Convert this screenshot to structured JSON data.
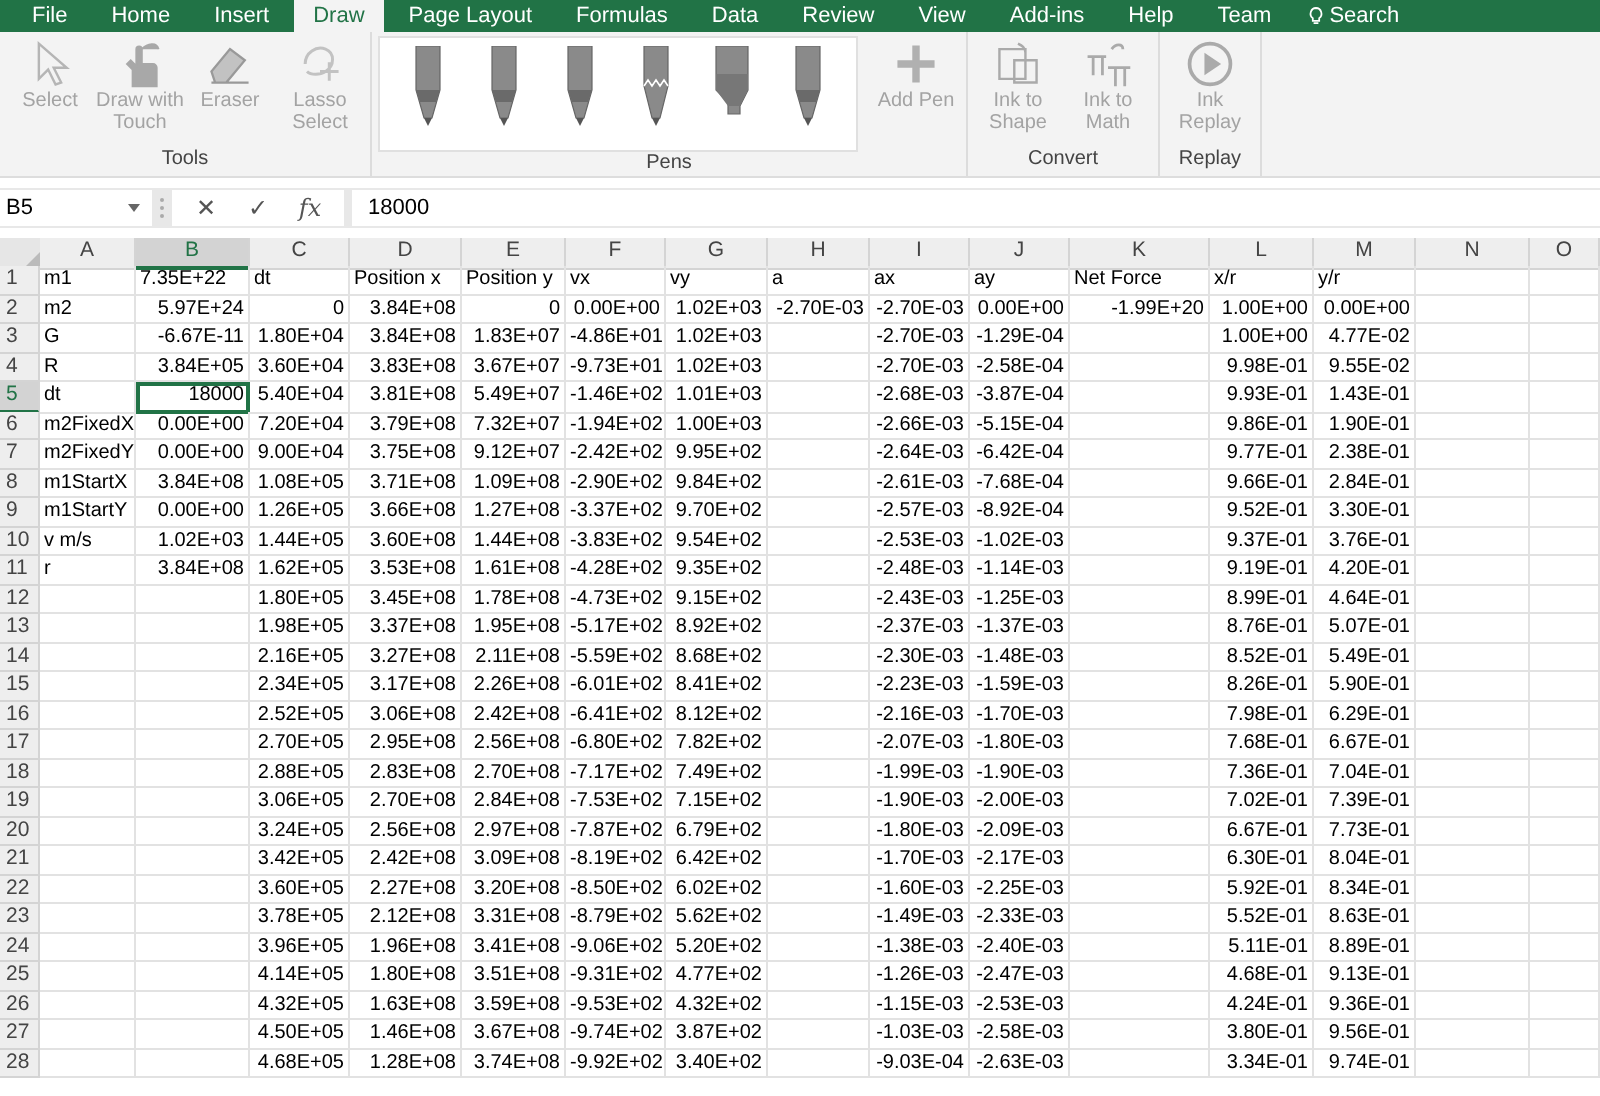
{
  "ribbon_tabs": [
    {
      "label": "File",
      "selected": false
    },
    {
      "label": "Home",
      "selected": false
    },
    {
      "label": "Insert",
      "selected": false
    },
    {
      "label": "Draw",
      "selected": true
    },
    {
      "label": "Page Layout",
      "selected": false
    },
    {
      "label": "Formulas",
      "selected": false
    },
    {
      "label": "Data",
      "selected": false
    },
    {
      "label": "Review",
      "selected": false
    },
    {
      "label": "View",
      "selected": false
    },
    {
      "label": "Add-ins",
      "selected": false
    },
    {
      "label": "Help",
      "selected": false
    },
    {
      "label": "Team",
      "selected": false
    }
  ],
  "tell_me": {
    "label": "Search"
  },
  "ribbon_groups": [
    {
      "label": "Tools",
      "buttons": [
        {
          "kind": "select",
          "label": "Select",
          "disabled": true
        },
        {
          "kind": "touch",
          "label": "Draw with Touch",
          "disabled": true
        },
        {
          "kind": "eraser",
          "label": "Eraser",
          "disabled": true
        },
        {
          "kind": "lasso",
          "label": "Lasso Select",
          "disabled": true
        }
      ]
    },
    {
      "label": "Pens",
      "pens": [
        {
          "kind": "pen"
        },
        {
          "kind": "pen"
        },
        {
          "kind": "pen"
        },
        {
          "kind": "pencil"
        },
        {
          "kind": "highlighter"
        },
        {
          "kind": "pen"
        }
      ],
      "buttons": [
        {
          "kind": "add",
          "label": "Add Pen",
          "disabled": true
        }
      ]
    },
    {
      "label": "Convert",
      "buttons": [
        {
          "kind": "shape",
          "label": "Ink to Shape",
          "disabled": true
        },
        {
          "kind": "math",
          "label": "Ink to Math",
          "disabled": true
        }
      ]
    },
    {
      "label": "Replay",
      "buttons": [
        {
          "kind": "replay",
          "label": "Ink Replay",
          "disabled": true
        }
      ]
    }
  ],
  "formula_bar": {
    "name_box": "B5",
    "cancel": "✕",
    "enter": "✓",
    "function": "fx",
    "value": "18000"
  },
  "sheet": {
    "columns": [
      {
        "label": "A",
        "selected": false
      },
      {
        "label": "B",
        "selected": true
      },
      {
        "label": "C",
        "selected": false
      },
      {
        "label": "D",
        "selected": false
      },
      {
        "label": "E",
        "selected": false
      },
      {
        "label": "F",
        "selected": false
      },
      {
        "label": "G",
        "selected": false
      },
      {
        "label": "H",
        "selected": false
      },
      {
        "label": "I",
        "selected": false
      },
      {
        "label": "J",
        "selected": false
      },
      {
        "label": "K",
        "selected": false
      },
      {
        "label": "L",
        "selected": false
      },
      {
        "label": "M",
        "selected": false
      },
      {
        "label": "N",
        "selected": false
      },
      {
        "label": "O",
        "selected": false
      }
    ],
    "rows": [
      {
        "number": "1",
        "selected": false,
        "cells": [
          "m1",
          "7.35E+22",
          "dt",
          "Position x",
          "Position y",
          "vx",
          "vy",
          "a",
          "ax",
          "ay",
          "Net Force",
          "x/r",
          "y/r"
        ]
      },
      {
        "number": "2",
        "selected": false,
        "cells": [
          "m2",
          "5.97E+24",
          "0",
          "3.84E+08",
          "0",
          "0.00E+00",
          "1.02E+03",
          "-2.70E-03",
          "-2.70E-03",
          "0.00E+00",
          "-1.99E+20",
          "1.00E+00",
          "0.00E+00"
        ]
      },
      {
        "number": "3",
        "selected": false,
        "cells": [
          "G",
          "-6.67E-11",
          "1.80E+04",
          "3.84E+08",
          "1.83E+07",
          "-4.86E+01",
          "1.02E+03",
          null,
          "-2.70E-03",
          "-1.29E-04",
          null,
          "1.00E+00",
          "4.77E-02"
        ]
      },
      {
        "number": "4",
        "selected": false,
        "cells": [
          "R",
          "3.84E+05",
          "3.60E+04",
          "3.83E+08",
          "3.67E+07",
          "-9.73E+01",
          "1.02E+03",
          null,
          "-2.70E-03",
          "-2.58E-04",
          null,
          "9.98E-01",
          "9.55E-02"
        ]
      },
      {
        "number": "5",
        "selected": true,
        "cells": [
          "dt",
          "18000",
          "5.40E+04",
          "3.81E+08",
          "5.49E+07",
          "-1.46E+02",
          "1.01E+03",
          null,
          "-2.68E-03",
          "-3.87E-04",
          null,
          "9.93E-01",
          "1.43E-01"
        ]
      },
      {
        "number": "6",
        "selected": false,
        "cells": [
          "m2FixedX",
          "0.00E+00",
          "7.20E+04",
          "3.79E+08",
          "7.32E+07",
          "-1.94E+02",
          "1.00E+03",
          null,
          "-2.66E-03",
          "-5.15E-04",
          null,
          "9.86E-01",
          "1.90E-01"
        ]
      },
      {
        "number": "7",
        "selected": false,
        "cells": [
          "m2FixedY",
          "0.00E+00",
          "9.00E+04",
          "3.75E+08",
          "9.12E+07",
          "-2.42E+02",
          "9.95E+02",
          null,
          "-2.64E-03",
          "-6.42E-04",
          null,
          "9.77E-01",
          "2.38E-01"
        ]
      },
      {
        "number": "8",
        "selected": false,
        "cells": [
          "m1StartX",
          "3.84E+08",
          "1.08E+05",
          "3.71E+08",
          "1.09E+08",
          "-2.90E+02",
          "9.84E+02",
          null,
          "-2.61E-03",
          "-7.68E-04",
          null,
          "9.66E-01",
          "2.84E-01"
        ]
      },
      {
        "number": "9",
        "selected": false,
        "cells": [
          "m1StartY",
          "0.00E+00",
          "1.26E+05",
          "3.66E+08",
          "1.27E+08",
          "-3.37E+02",
          "9.70E+02",
          null,
          "-2.57E-03",
          "-8.92E-04",
          null,
          "9.52E-01",
          "3.30E-01"
        ]
      },
      {
        "number": "10",
        "selected": false,
        "cells": [
          "v m/s",
          "1.02E+03",
          "1.44E+05",
          "3.60E+08",
          "1.44E+08",
          "-3.83E+02",
          "9.54E+02",
          null,
          "-2.53E-03",
          "-1.02E-03",
          null,
          "9.37E-01",
          "3.76E-01"
        ]
      },
      {
        "number": "11",
        "selected": false,
        "cells": [
          "r",
          "3.84E+08",
          "1.62E+05",
          "3.53E+08",
          "1.61E+08",
          "-4.28E+02",
          "9.35E+02",
          null,
          "-2.48E-03",
          "-1.14E-03",
          null,
          "9.19E-01",
          "4.20E-01"
        ]
      },
      {
        "number": "12",
        "selected": false,
        "cells": [
          null,
          null,
          "1.80E+05",
          "3.45E+08",
          "1.78E+08",
          "-4.73E+02",
          "9.15E+02",
          null,
          "-2.43E-03",
          "-1.25E-03",
          null,
          "8.99E-01",
          "4.64E-01"
        ]
      },
      {
        "number": "13",
        "selected": false,
        "cells": [
          null,
          null,
          "1.98E+05",
          "3.37E+08",
          "1.95E+08",
          "-5.17E+02",
          "8.92E+02",
          null,
          "-2.37E-03",
          "-1.37E-03",
          null,
          "8.76E-01",
          "5.07E-01"
        ]
      },
      {
        "number": "14",
        "selected": false,
        "cells": [
          null,
          null,
          "2.16E+05",
          "3.27E+08",
          "2.11E+08",
          "-5.59E+02",
          "8.68E+02",
          null,
          "-2.30E-03",
          "-1.48E-03",
          null,
          "8.52E-01",
          "5.49E-01"
        ]
      },
      {
        "number": "15",
        "selected": false,
        "cells": [
          null,
          null,
          "2.34E+05",
          "3.17E+08",
          "2.26E+08",
          "-6.01E+02",
          "8.41E+02",
          null,
          "-2.23E-03",
          "-1.59E-03",
          null,
          "8.26E-01",
          "5.90E-01"
        ]
      },
      {
        "number": "16",
        "selected": false,
        "cells": [
          null,
          null,
          "2.52E+05",
          "3.06E+08",
          "2.42E+08",
          "-6.41E+02",
          "8.12E+02",
          null,
          "-2.16E-03",
          "-1.70E-03",
          null,
          "7.98E-01",
          "6.29E-01"
        ]
      },
      {
        "number": "17",
        "selected": false,
        "cells": [
          null,
          null,
          "2.70E+05",
          "2.95E+08",
          "2.56E+08",
          "-6.80E+02",
          "7.82E+02",
          null,
          "-2.07E-03",
          "-1.80E-03",
          null,
          "7.68E-01",
          "6.67E-01"
        ]
      },
      {
        "number": "18",
        "selected": false,
        "cells": [
          null,
          null,
          "2.88E+05",
          "2.83E+08",
          "2.70E+08",
          "-7.17E+02",
          "7.49E+02",
          null,
          "-1.99E-03",
          "-1.90E-03",
          null,
          "7.36E-01",
          "7.04E-01"
        ]
      },
      {
        "number": "19",
        "selected": false,
        "cells": [
          null,
          null,
          "3.06E+05",
          "2.70E+08",
          "2.84E+08",
          "-7.53E+02",
          "7.15E+02",
          null,
          "-1.90E-03",
          "-2.00E-03",
          null,
          "7.02E-01",
          "7.39E-01"
        ]
      },
      {
        "number": "20",
        "selected": false,
        "cells": [
          null,
          null,
          "3.24E+05",
          "2.56E+08",
          "2.97E+08",
          "-7.87E+02",
          "6.79E+02",
          null,
          "-1.80E-03",
          "-2.09E-03",
          null,
          "6.67E-01",
          "7.73E-01"
        ]
      },
      {
        "number": "21",
        "selected": false,
        "cells": [
          null,
          null,
          "3.42E+05",
          "2.42E+08",
          "3.09E+08",
          "-8.19E+02",
          "6.42E+02",
          null,
          "-1.70E-03",
          "-2.17E-03",
          null,
          "6.30E-01",
          "8.04E-01"
        ]
      },
      {
        "number": "22",
        "selected": false,
        "cells": [
          null,
          null,
          "3.60E+05",
          "2.27E+08",
          "3.20E+08",
          "-8.50E+02",
          "6.02E+02",
          null,
          "-1.60E-03",
          "-2.25E-03",
          null,
          "5.92E-01",
          "8.34E-01"
        ]
      },
      {
        "number": "23",
        "selected": false,
        "cells": [
          null,
          null,
          "3.78E+05",
          "2.12E+08",
          "3.31E+08",
          "-8.79E+02",
          "5.62E+02",
          null,
          "-1.49E-03",
          "-2.33E-03",
          null,
          "5.52E-01",
          "8.63E-01"
        ]
      },
      {
        "number": "24",
        "selected": false,
        "cells": [
          null,
          null,
          "3.96E+05",
          "1.96E+08",
          "3.41E+08",
          "-9.06E+02",
          "5.20E+02",
          null,
          "-1.38E-03",
          "-2.40E-03",
          null,
          "5.11E-01",
          "8.89E-01"
        ]
      },
      {
        "number": "25",
        "selected": false,
        "cells": [
          null,
          null,
          "4.14E+05",
          "1.80E+08",
          "3.51E+08",
          "-9.31E+02",
          "4.77E+02",
          null,
          "-1.26E-03",
          "-2.47E-03",
          null,
          "4.68E-01",
          "9.13E-01"
        ]
      },
      {
        "number": "26",
        "selected": false,
        "cells": [
          null,
          null,
          "4.32E+05",
          "1.63E+08",
          "3.59E+08",
          "-9.53E+02",
          "4.32E+02",
          null,
          "-1.15E-03",
          "-2.53E-03",
          null,
          "4.24E-01",
          "9.36E-01"
        ]
      },
      {
        "number": "27",
        "selected": false,
        "cells": [
          null,
          null,
          "4.50E+05",
          "1.46E+08",
          "3.67E+08",
          "-9.74E+02",
          "3.87E+02",
          null,
          "-1.03E-03",
          "-2.58E-03",
          null,
          "3.80E-01",
          "9.56E-01"
        ]
      },
      {
        "number": "28",
        "selected": false,
        "cells": [
          null,
          null,
          "4.68E+05",
          "1.28E+08",
          "3.74E+08",
          "-9.92E+02",
          "3.40E+02",
          null,
          "-9.03E-04",
          "-2.63E-03",
          null,
          "3.34E-01",
          "9.74E-01"
        ]
      }
    ]
  }
}
